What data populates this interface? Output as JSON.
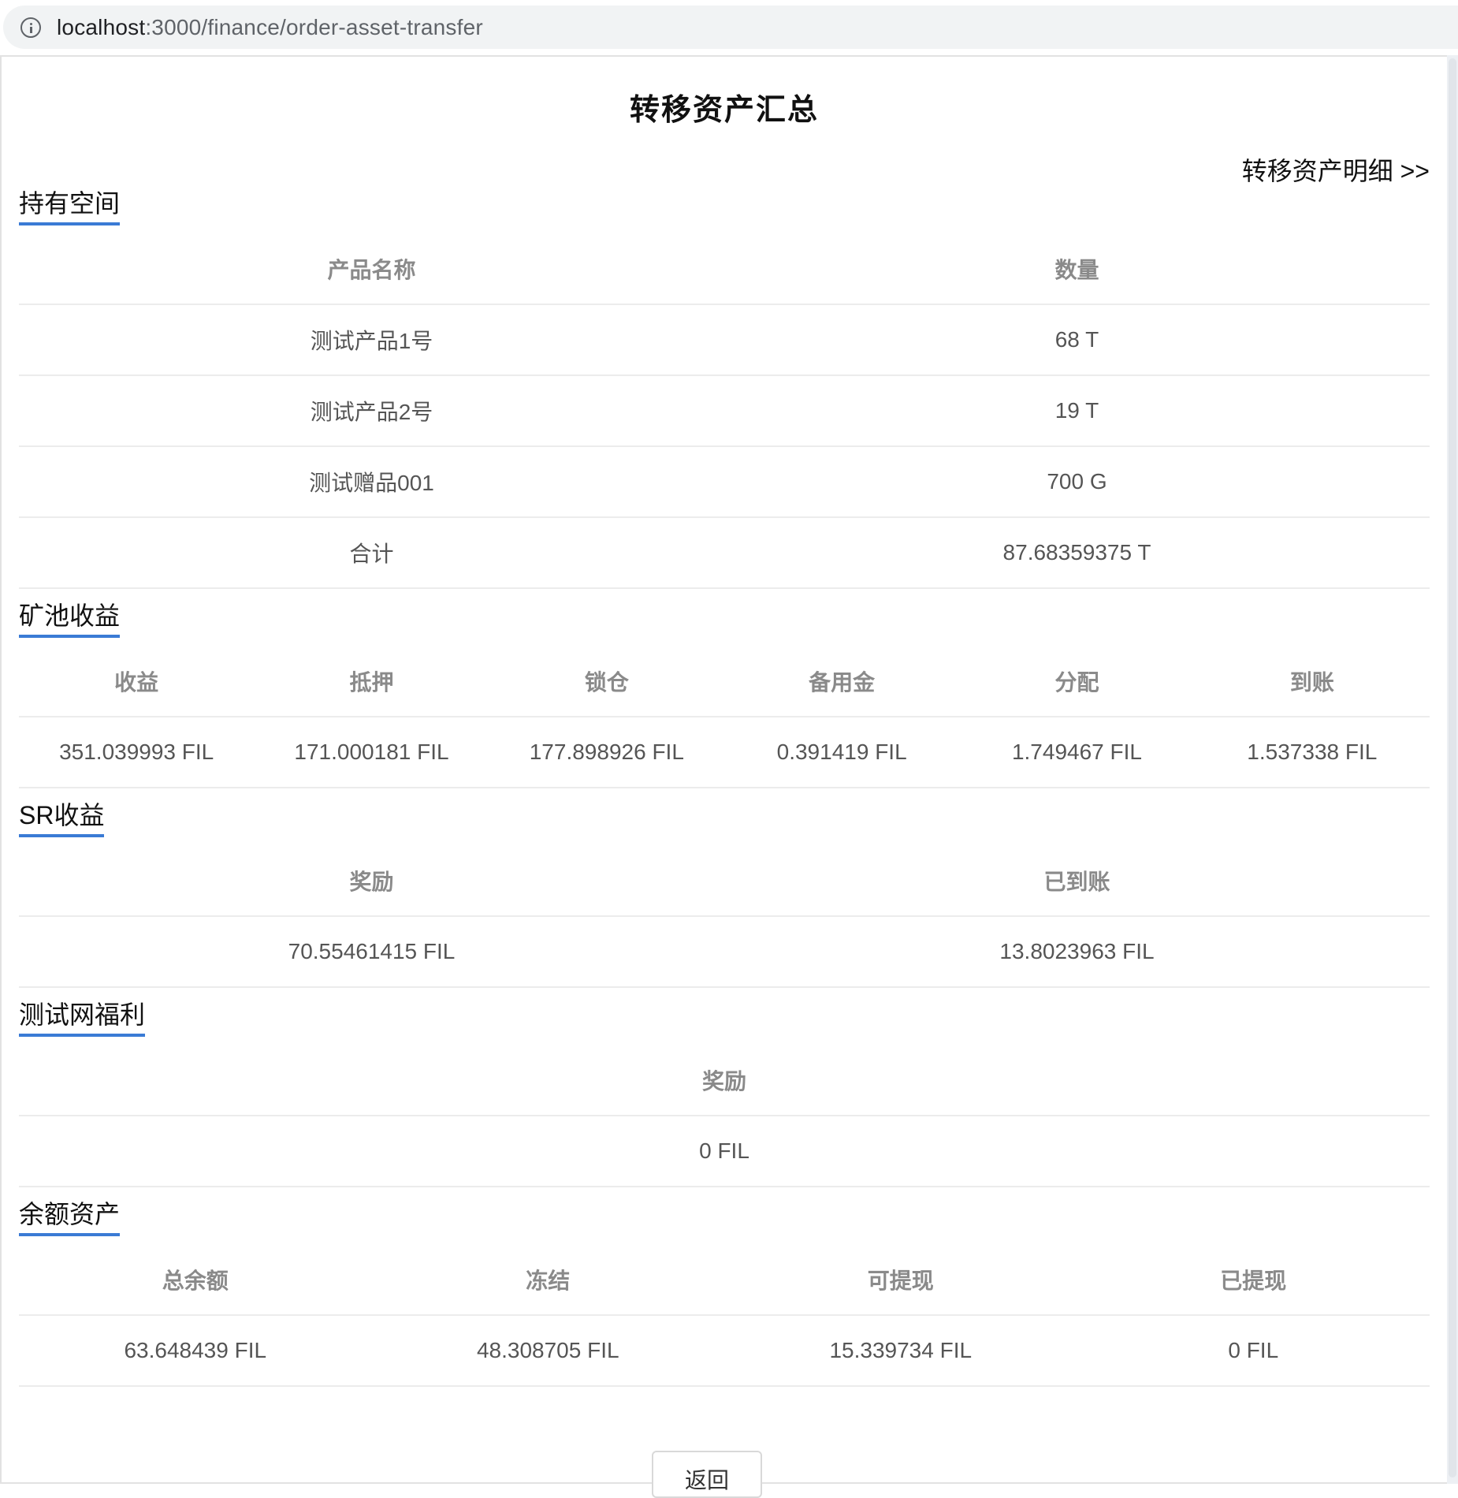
{
  "browser": {
    "url_host": "localhost",
    "url_path": ":3000/finance/order-asset-transfer"
  },
  "page": {
    "title": "转移资产汇总",
    "detail_link": "转移资产明细 >>",
    "back_button": "返回"
  },
  "holding_space": {
    "title": "持有空间",
    "headers": [
      "产品名称",
      "数量"
    ],
    "rows": [
      [
        "测试产品1号",
        "68 T"
      ],
      [
        "测试产品2号",
        "19 T"
      ],
      [
        "测试赠品001",
        "700 G"
      ],
      [
        "合计",
        "87.68359375 T"
      ]
    ]
  },
  "pool_income": {
    "title": "矿池收益",
    "headers": [
      "收益",
      "抵押",
      "锁仓",
      "备用金",
      "分配",
      "到账"
    ],
    "rows": [
      [
        "351.039993 FIL",
        "171.000181 FIL",
        "177.898926 FIL",
        "0.391419 FIL",
        "1.749467 FIL",
        "1.537338 FIL"
      ]
    ]
  },
  "sr_income": {
    "title": "SR收益",
    "headers": [
      "奖励",
      "已到账"
    ],
    "rows": [
      [
        "70.55461415 FIL",
        "13.8023963 FIL"
      ]
    ]
  },
  "testnet_welfare": {
    "title": "测试网福利",
    "headers": [
      "奖励"
    ],
    "rows": [
      [
        "0 FIL"
      ]
    ]
  },
  "balance_assets": {
    "title": "余额资产",
    "headers": [
      "总余额",
      "冻结",
      "可提现",
      "已提现"
    ],
    "rows": [
      [
        "63.648439 FIL",
        "48.308705 FIL",
        "15.339734 FIL",
        "0 FIL"
      ]
    ]
  }
}
